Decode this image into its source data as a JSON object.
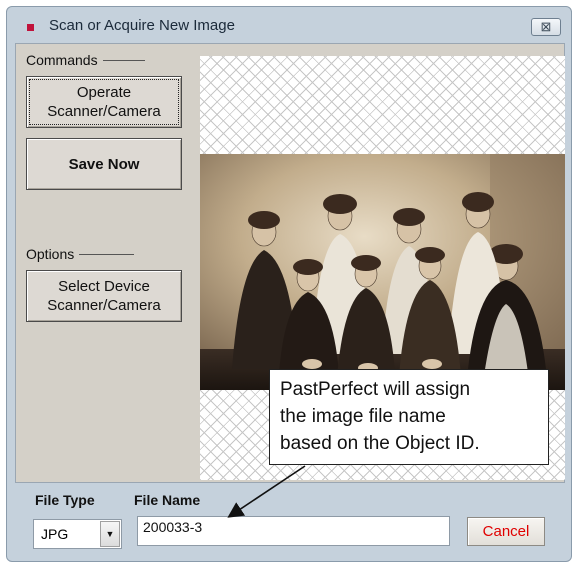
{
  "window": {
    "title": "Scan or Acquire New Image",
    "close_glyph": "⊠"
  },
  "commands": {
    "label": "Commands",
    "operate_line1": "Operate",
    "operate_line2": "Scanner/Camera",
    "save_label": "Save Now"
  },
  "options": {
    "label": "Options",
    "select_line1": "Select Device",
    "select_line2": "Scanner/Camera"
  },
  "preview": {
    "image": "sepia group photograph of nine women",
    "callout_line1": "PastPerfect will assign",
    "callout_line2": "the image file name",
    "callout_line3": "based on the Object ID."
  },
  "footer": {
    "file_type_label": "File Type",
    "file_type_value": "JPG",
    "file_name_label": "File Name",
    "file_name_value": "200033-3",
    "cancel_label": "Cancel"
  },
  "colors": {
    "title_icon": "#c0123b",
    "cancel_text": "#e00000"
  },
  "icons": {
    "title": "app-icon",
    "close": "close-icon",
    "dropdown": "chevron-down-icon"
  }
}
